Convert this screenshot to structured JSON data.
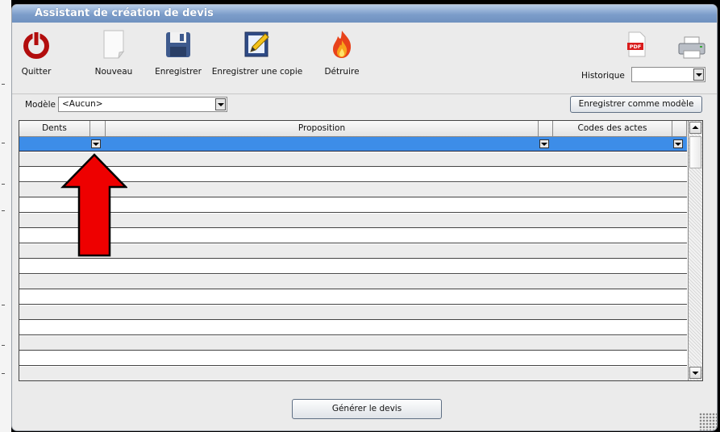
{
  "window": {
    "title": "Assistant de création de devis"
  },
  "toolbar": {
    "quit": {
      "label": "Quitter",
      "icon": "power-icon"
    },
    "new": {
      "label": "Nouveau",
      "icon": "new-document-icon"
    },
    "save": {
      "label": "Enregistrer",
      "icon": "floppy-disk-icon"
    },
    "save_copy": {
      "label": "Enregistrer une copie",
      "icon": "edit-pencil-icon"
    },
    "destroy": {
      "label": "Détruire",
      "icon": "fire-icon"
    },
    "pdf": {
      "icon": "pdf-icon",
      "badge": "PDF"
    },
    "print": {
      "icon": "printer-icon"
    },
    "history_label": "Historique",
    "history_value": ""
  },
  "model": {
    "label": "Modèle",
    "value": "<Aucun>",
    "save_as_model": "Enregistrer comme modèle"
  },
  "grid": {
    "columns": [
      "Dents",
      "",
      "Proposition",
      "",
      "Codes des actes",
      ""
    ],
    "row_count": 16,
    "selected_row": 0
  },
  "footer": {
    "generate_button": "Générer le devis"
  },
  "colors": {
    "title_bar": "#7c9dca",
    "selected_row": "#3d8de8",
    "arrow": "#e00000"
  }
}
